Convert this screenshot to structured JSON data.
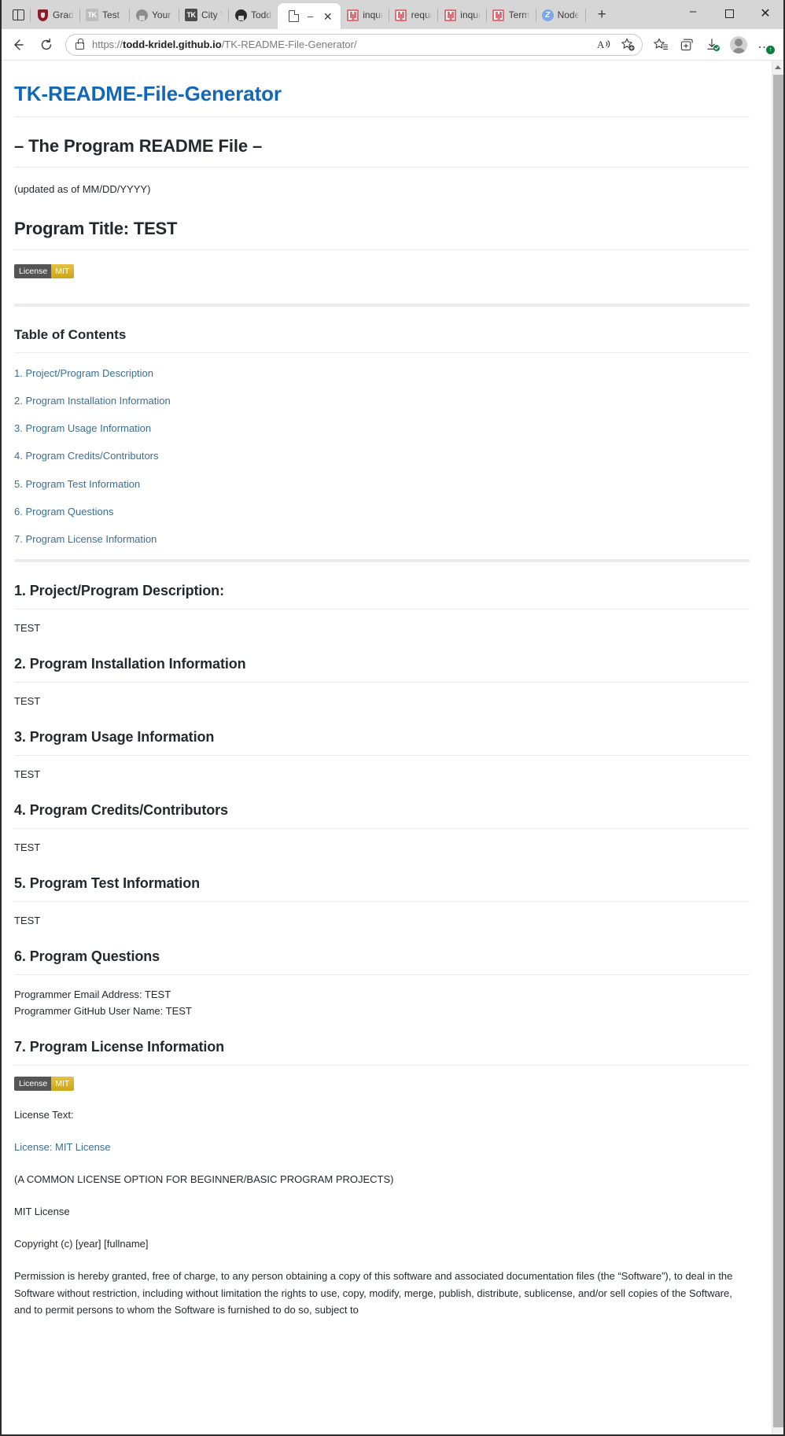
{
  "browser": {
    "vertical_tabs_icon": "vertical-tabs-icon",
    "tabs": [
      {
        "label": "Grade",
        "favicon": "gradescope-shield-icon",
        "active": false
      },
      {
        "label": "Test C",
        "favicon": "tk-light-icon",
        "active": false
      },
      {
        "label": "Your P",
        "favicon": "github-icon",
        "active": false
      },
      {
        "label": "City V",
        "favicon": "tk-dark-icon",
        "active": false
      },
      {
        "label": "Todd-",
        "favicon": "github-icon",
        "active": false
      },
      {
        "label": "",
        "favicon": "document-icon",
        "active": true,
        "dash": "–"
      },
      {
        "label": "inqui",
        "favicon": "npm-icon",
        "active": false
      },
      {
        "label": "requi",
        "favicon": "npm-icon",
        "active": false
      },
      {
        "label": "inqui",
        "favicon": "npm-icon",
        "active": false
      },
      {
        "label": "Terms",
        "favicon": "npm-icon",
        "active": false
      },
      {
        "label": "Node",
        "favicon": "zoom-icon",
        "active": false
      }
    ],
    "new_tab_label": "+",
    "window_controls": {
      "minimize": "–",
      "maximize": "maximize-icon",
      "close": "✕"
    },
    "nav": {
      "back": "back-arrow-icon",
      "reload": "reload-icon"
    },
    "url": {
      "prefix": "https://",
      "host": "todd-kridel.github.io",
      "path": "/TK-README-File-Generator/"
    },
    "toolbar_icons": [
      "read-aloud-icon",
      "add-favorite-icon",
      "favorites-icon",
      "collections-icon",
      "downloads-icon",
      "profile-avatar-icon",
      "settings-more-icon"
    ]
  },
  "page": {
    "repo_title": "TK-README-File-Generator",
    "subtitle": "– The Program README File –",
    "updated_note": "(updated as of MM/DD/YYYY)",
    "program_title": "Program Title: TEST",
    "badge": {
      "left": "License",
      "right": "MIT",
      "left_color": "#555555",
      "right_color": "#dfb317"
    },
    "toc_heading": "Table of Contents",
    "toc": [
      "1. Project/Program Description",
      "2. Program Installation Information",
      "3. Program Usage Information",
      "4. Program Credits/Contributors",
      "5. Program Test Information",
      "6. Program Questions",
      "7. Program License Information"
    ],
    "sections": [
      {
        "heading": "1. Project/Program Description:",
        "body": "TEST"
      },
      {
        "heading": "2. Program Installation Information",
        "body": "TEST"
      },
      {
        "heading": "3. Program Usage Information",
        "body": "TEST"
      },
      {
        "heading": "4. Program Credits/Contributors",
        "body": "TEST"
      },
      {
        "heading": "5. Program Test Information",
        "body": "TEST"
      }
    ],
    "questions": {
      "heading": "6. Program Questions",
      "email_line": "Programmer Email Address: TEST",
      "github_line": "Programmer GitHub User Name: TEST"
    },
    "license": {
      "heading": "7. Program License Information",
      "license_text_label": "License Text:",
      "license_link": "License: MIT License",
      "common_note": "(A COMMON LICENSE OPTION FOR BEGINNER/BASIC PROGRAM PROJECTS)",
      "mit_title": "MIT License",
      "copyright": "Copyright (c) [year] [fullname]",
      "permission": "Permission is hereby granted, free of charge, to any person obtaining a copy of this software and associated documentation files (the “Software”), to deal in the Software without restriction, including without limitation the rights to use, copy, modify, merge, publish, distribute, sublicense, and/or sell copies of the Software, and to permit persons to whom the Software is furnished to do so, subject to"
    }
  }
}
